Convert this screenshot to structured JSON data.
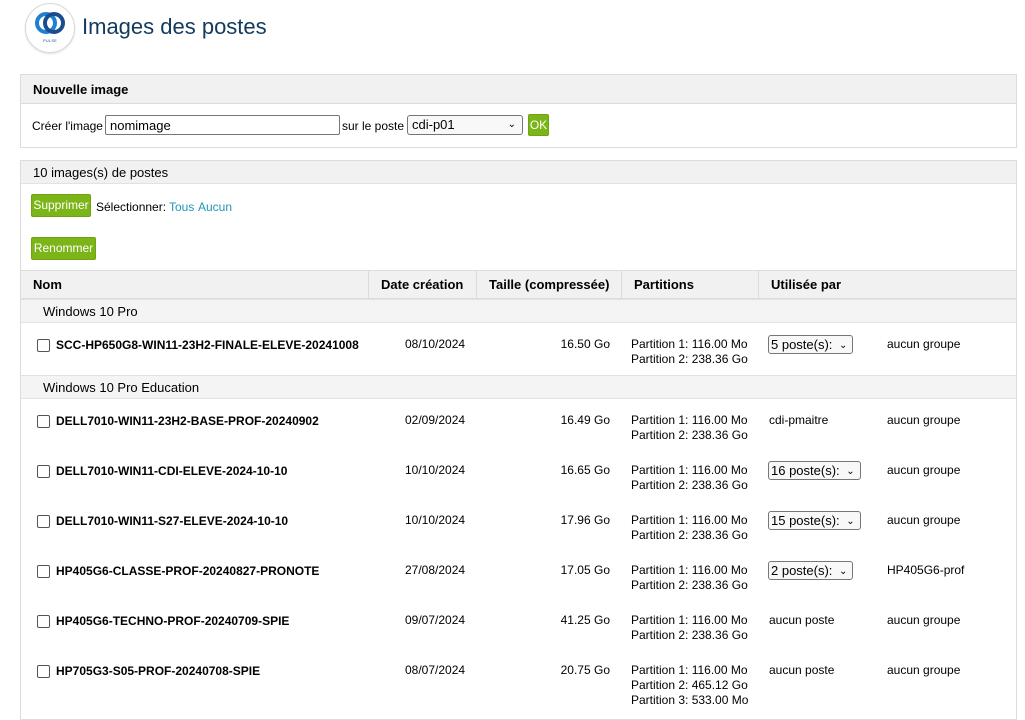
{
  "page": {
    "title": "Images des postes"
  },
  "logo": {
    "brand_text": "PULSE"
  },
  "new_image": {
    "heading": "Nouvelle image",
    "create_label": "Créer l'image",
    "name_value": "nomimage",
    "on_label": "sur le poste",
    "poste_selected": "cdi-p01",
    "ok_label": "OK"
  },
  "images": {
    "heading": "10 images(s) de postes",
    "delete_label": "Supprimer",
    "select_label": "Sélectionner:",
    "select_all": "Tous",
    "select_none": "Aucun",
    "rename_label": "Renommer",
    "columns": {
      "name": "Nom",
      "date": "Date création",
      "size": "Taille (compressée)",
      "partitions": "Partitions",
      "used_by": "Utilisée par"
    },
    "groups": [
      {
        "label": "Windows 10 Pro",
        "rows": [
          {
            "name": "SCC-HP650G8-WIN11-23H2-FINALE-ELEVE-20241008",
            "date": "08/10/2024",
            "size": "16.50 Go",
            "partitions": [
              "Partition 1: 116.00 Mo",
              "Partition 2: 238.36 Go"
            ],
            "used": "5 poste(s):",
            "used_select": true,
            "group": "aucun groupe"
          }
        ]
      },
      {
        "label": "Windows 10 Pro Education",
        "rows": [
          {
            "name": "DELL7010-WIN11-23H2-BASE-PROF-20240902",
            "date": "02/09/2024",
            "size": "16.49 Go",
            "partitions": [
              "Partition 1: 116.00 Mo",
              "Partition 2: 238.36 Go"
            ],
            "used": "cdi-pmaitre",
            "used_select": false,
            "group": "aucun groupe"
          },
          {
            "name": "DELL7010-WIN11-CDI-ELEVE-2024-10-10",
            "date": "10/10/2024",
            "size": "16.65 Go",
            "partitions": [
              "Partition 1: 116.00 Mo",
              "Partition 2: 238.36 Go"
            ],
            "used": "16 poste(s):",
            "used_select": true,
            "group": "aucun groupe"
          },
          {
            "name": "DELL7010-WIN11-S27-ELEVE-2024-10-10",
            "date": "10/10/2024",
            "size": "17.96 Go",
            "partitions": [
              "Partition 1: 116.00 Mo",
              "Partition 2: 238.36 Go"
            ],
            "used": "15 poste(s):",
            "used_select": true,
            "group": "aucun groupe"
          },
          {
            "name": "HP405G6-CLASSE-PROF-20240827-PRONOTE",
            "date": "27/08/2024",
            "size": "17.05 Go",
            "partitions": [
              "Partition 1: 116.00 Mo",
              "Partition 2: 238.36 Go"
            ],
            "used": "2 poste(s):",
            "used_select": true,
            "group": "HP405G6-prof"
          },
          {
            "name": "HP405G6-TECHNO-PROF-20240709-SPIE",
            "date": "09/07/2024",
            "size": "41.25 Go",
            "partitions": [
              "Partition 1: 116.00 Mo",
              "Partition 2: 238.36 Go"
            ],
            "used": "aucun poste",
            "used_select": false,
            "group": "aucun groupe"
          },
          {
            "name": "HP705G3-S05-PROF-20240708-SPIE",
            "date": "08/07/2024",
            "size": "20.75 Go",
            "partitions": [
              "Partition 1: 116.00 Mo",
              "Partition 2: 465.12 Go",
              "Partition 3: 533.00 Mo"
            ],
            "used": "aucun poste",
            "used_select": false,
            "group": "aucun groupe"
          }
        ]
      }
    ]
  }
}
